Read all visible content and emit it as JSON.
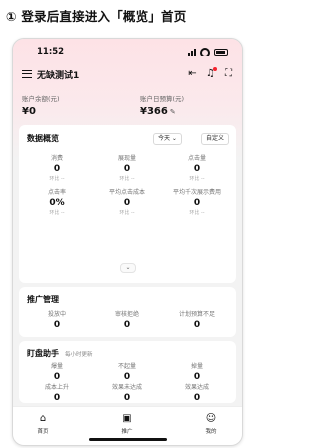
{
  "caption": "① 登录后直接进入「概览」首页",
  "status_bar": {
    "time": "11:52"
  },
  "header": {
    "account_name": "无缺测试1"
  },
  "balances": {
    "balance_label": "账户余额(元)",
    "balance_value": "¥0",
    "budget_label": "账户日预算(元)",
    "budget_value": "¥366"
  },
  "overview": {
    "title": "数据概览",
    "range": "今天 ⌄",
    "custom": "自定义",
    "metrics": [
      {
        "label": "消费",
        "value": "0",
        "compare": "环比 --"
      },
      {
        "label": "展现量",
        "value": "0",
        "compare": "环比 --"
      },
      {
        "label": "点击量",
        "value": "0",
        "compare": "环比 --"
      },
      {
        "label": "点击率",
        "value": "0%",
        "compare": "环比 --"
      },
      {
        "label": "平均点击成本",
        "value": "0",
        "compare": "环比 --"
      },
      {
        "label": "平均千次展示费用",
        "value": "0",
        "compare": "环比 --"
      }
    ],
    "expand_icon": "⌄"
  },
  "promotion": {
    "title": "推广管理",
    "items": [
      {
        "label": "投放中",
        "value": "0"
      },
      {
        "label": "审核拒绝",
        "value": "0"
      },
      {
        "label": "计划预算不足",
        "value": "0"
      }
    ]
  },
  "assistant": {
    "title": "盯盘助手",
    "subtitle": "每小时更新",
    "items": [
      {
        "label": "爆量",
        "value": "0"
      },
      {
        "label": "不起量",
        "value": "0"
      },
      {
        "label": "掉量",
        "value": "0"
      },
      {
        "label": "成本上升",
        "value": "0"
      },
      {
        "label": "效果未达成",
        "value": "0"
      },
      {
        "label": "效果达成",
        "value": "0"
      }
    ]
  },
  "tabs": [
    {
      "label": "首页",
      "icon": "home-icon",
      "glyph": "⌂"
    },
    {
      "label": "推广",
      "icon": "grid-icon",
      "glyph": "▣"
    },
    {
      "label": "我的",
      "icon": "user-icon",
      "glyph": "☺"
    }
  ]
}
